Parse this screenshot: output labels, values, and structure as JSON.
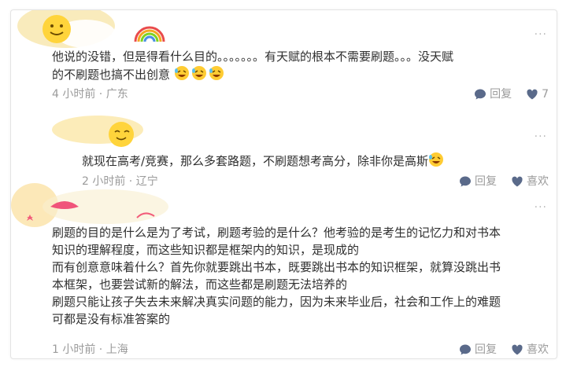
{
  "comments": [
    {
      "text": "他说的没错，但是得看什么目的。。。。。。。有天赋的根本不需要刷题。。。没天赋\n的不刷题也搞不出创意",
      "laugh_count": 3,
      "meta": "4 小时前 · 广东",
      "reply_label": "回复",
      "like_count": "7",
      "more": "···"
    },
    {
      "text": "就现在高考/竞赛，那么多套路题，不刷题想考高分，除非你是高斯",
      "meta": "2 小时前 · 辽宁",
      "reply_label": "回复",
      "like_label": "喜欢",
      "more": "···"
    },
    {
      "text": "刷题的目的是什么是为了考试，刷题考验的是什么？他考验的是考生的记忆力和对书本\n知识的理解程度，而这些知识都是框架内的知识，是现成的\n而有创意意味着什么？首先你就要跳出书本，既要跳出书本的知识框架，就算没跳出书\n本框架，也要尝试新的解法，而这些都是刷题无法培养的\n刷题只能让孩子失去未来解决真实问题的能力，因为未来毕业后，社会和工作上的难题\n可都是没有标准答案的",
      "meta": "1 小时前 · 上海",
      "reply_label": "回复",
      "like_label": "喜欢",
      "more": "···"
    }
  ],
  "colors": {
    "text": "#2f2f2f",
    "muted": "#9b9b9b",
    "icon": "#5a6a8a"
  }
}
